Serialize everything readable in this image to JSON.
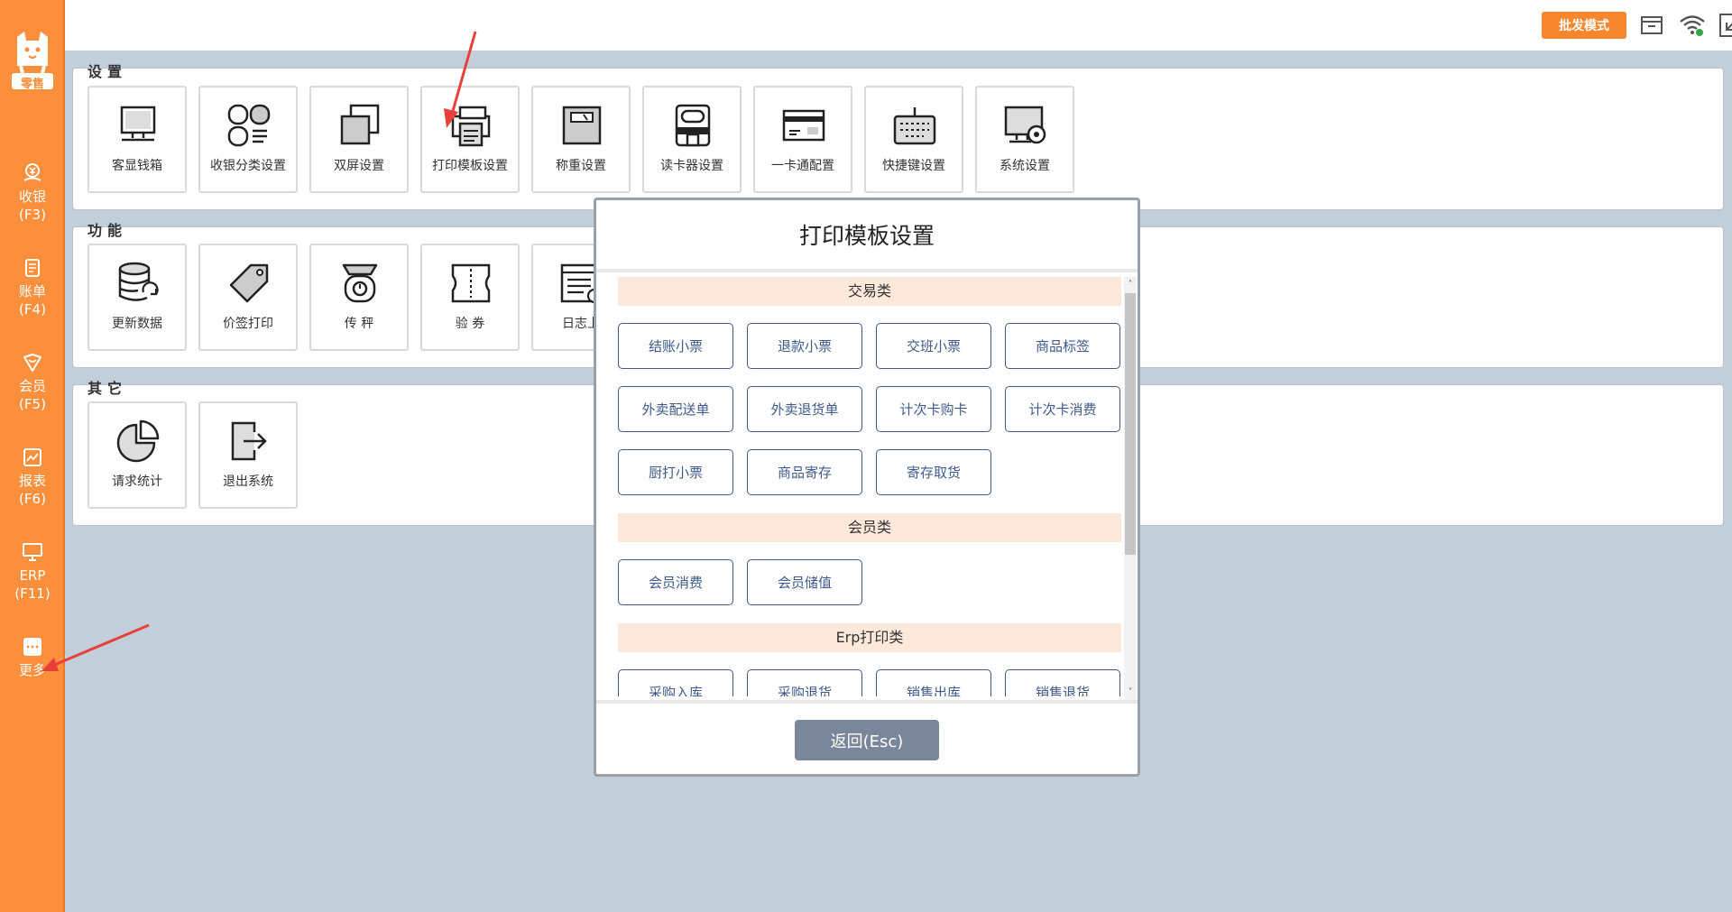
{
  "sidebar": {
    "logo_text": "零售",
    "items": [
      {
        "label": "收银",
        "key": "(F3)"
      },
      {
        "label": "账单",
        "key": "(F4)"
      },
      {
        "label": "会员",
        "key": "(F5)"
      },
      {
        "label": "报表",
        "key": "(F6)"
      },
      {
        "label": "ERP",
        "key": "(F11)"
      },
      {
        "label": "更多",
        "key": ""
      }
    ]
  },
  "topbar": {
    "mode_button": "批发模式",
    "icons": [
      "cash-drawer-icon",
      "wifi-icon",
      "minimize-window-icon",
      "close-window-icon"
    ]
  },
  "sections": {
    "settings": {
      "title": "设置",
      "tiles": [
        "客显钱箱",
        "收银分类设置",
        "双屏设置",
        "打印模板设置",
        "称重设置",
        "读卡器设置",
        "一卡通配置",
        "快捷键设置",
        "系统设置"
      ]
    },
    "functions": {
      "title": "功能",
      "tiles": [
        "更新数据",
        "价签打印",
        "传 秤",
        "验 券",
        "日志上"
      ]
    },
    "others": {
      "title": "其它",
      "tiles": [
        "请求统计",
        "退出系统"
      ]
    }
  },
  "modal": {
    "title": "打印模板设置",
    "categories": [
      {
        "name": "交易类",
        "buttons": [
          "结账小票",
          "退款小票",
          "交班小票",
          "商品标签",
          "外卖配送单",
          "外卖退货单",
          "计次卡购卡",
          "计次卡消费",
          "厨打小票",
          "商品寄存",
          "寄存取货"
        ]
      },
      {
        "name": "会员类",
        "buttons": [
          "会员消费",
          "会员储值"
        ]
      },
      {
        "name": "Erp打印类",
        "buttons": [
          "采购入库",
          "采购退货",
          "销售出库",
          "销售退货"
        ]
      }
    ],
    "back_button": "返回(Esc)",
    "scroll_up": "˄",
    "scroll_down": "˅"
  },
  "colors": {
    "sidebar": "#fb8f3c",
    "accent_button": "#f7862c",
    "background": "#c3cedb",
    "template_button_border": "#3e5a8c",
    "category_bar": "#fde9dc",
    "back_button": "#7a8699",
    "annotation_arrow": "#e8403a"
  }
}
